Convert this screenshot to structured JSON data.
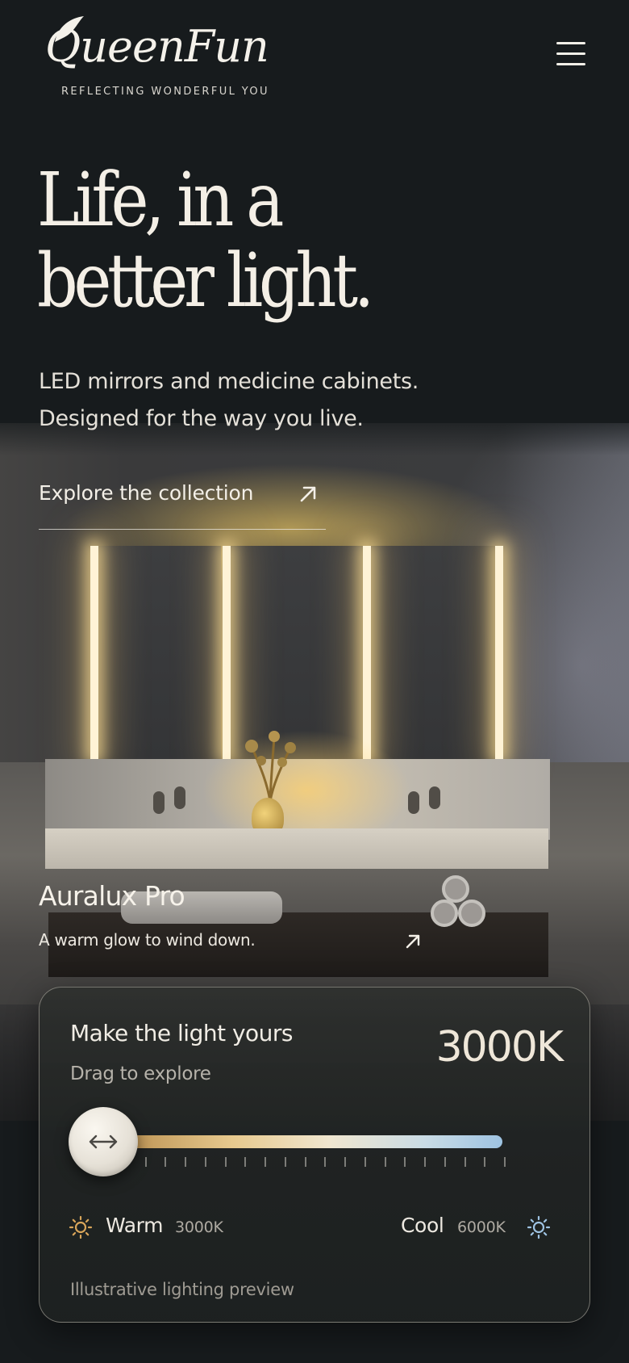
{
  "brand": {
    "name": "QueenFun",
    "tagline": "REFLECTING WONDERFUL YOU",
    "menu_icon": "hamburger-icon"
  },
  "hero": {
    "title_line1": "Life, in a",
    "title_line2": "better light.",
    "subtitle_line1": "LED mirrors and medicine cabinets.",
    "subtitle_line2": "Designed for the way you live.",
    "cta_label": "Explore the collection",
    "cta_icon": "arrow-up-right-icon"
  },
  "product": {
    "name": "Auralux Pro",
    "description": "A warm glow to wind down.",
    "link_icon": "arrow-up-right-icon"
  },
  "light_control": {
    "title": "Make the light yours",
    "subtitle": "Drag to explore",
    "current_value": "3000K",
    "slider_position": 0,
    "warm": {
      "label": "Warm",
      "value": "3000K",
      "icon": "sun-warm-icon",
      "color": "#d8a55a"
    },
    "cool": {
      "label": "Cool",
      "value": "6000K",
      "icon": "sun-cool-icon",
      "color": "#9ec3e2"
    },
    "thumb_icon": "horizontal-arrows-icon",
    "footnote": "Illustrative lighting preview"
  },
  "colors": {
    "background": "#171b1d",
    "text": "#efebe3",
    "warm_accent": "#d8a55a",
    "cool_accent": "#9ec3e2"
  }
}
